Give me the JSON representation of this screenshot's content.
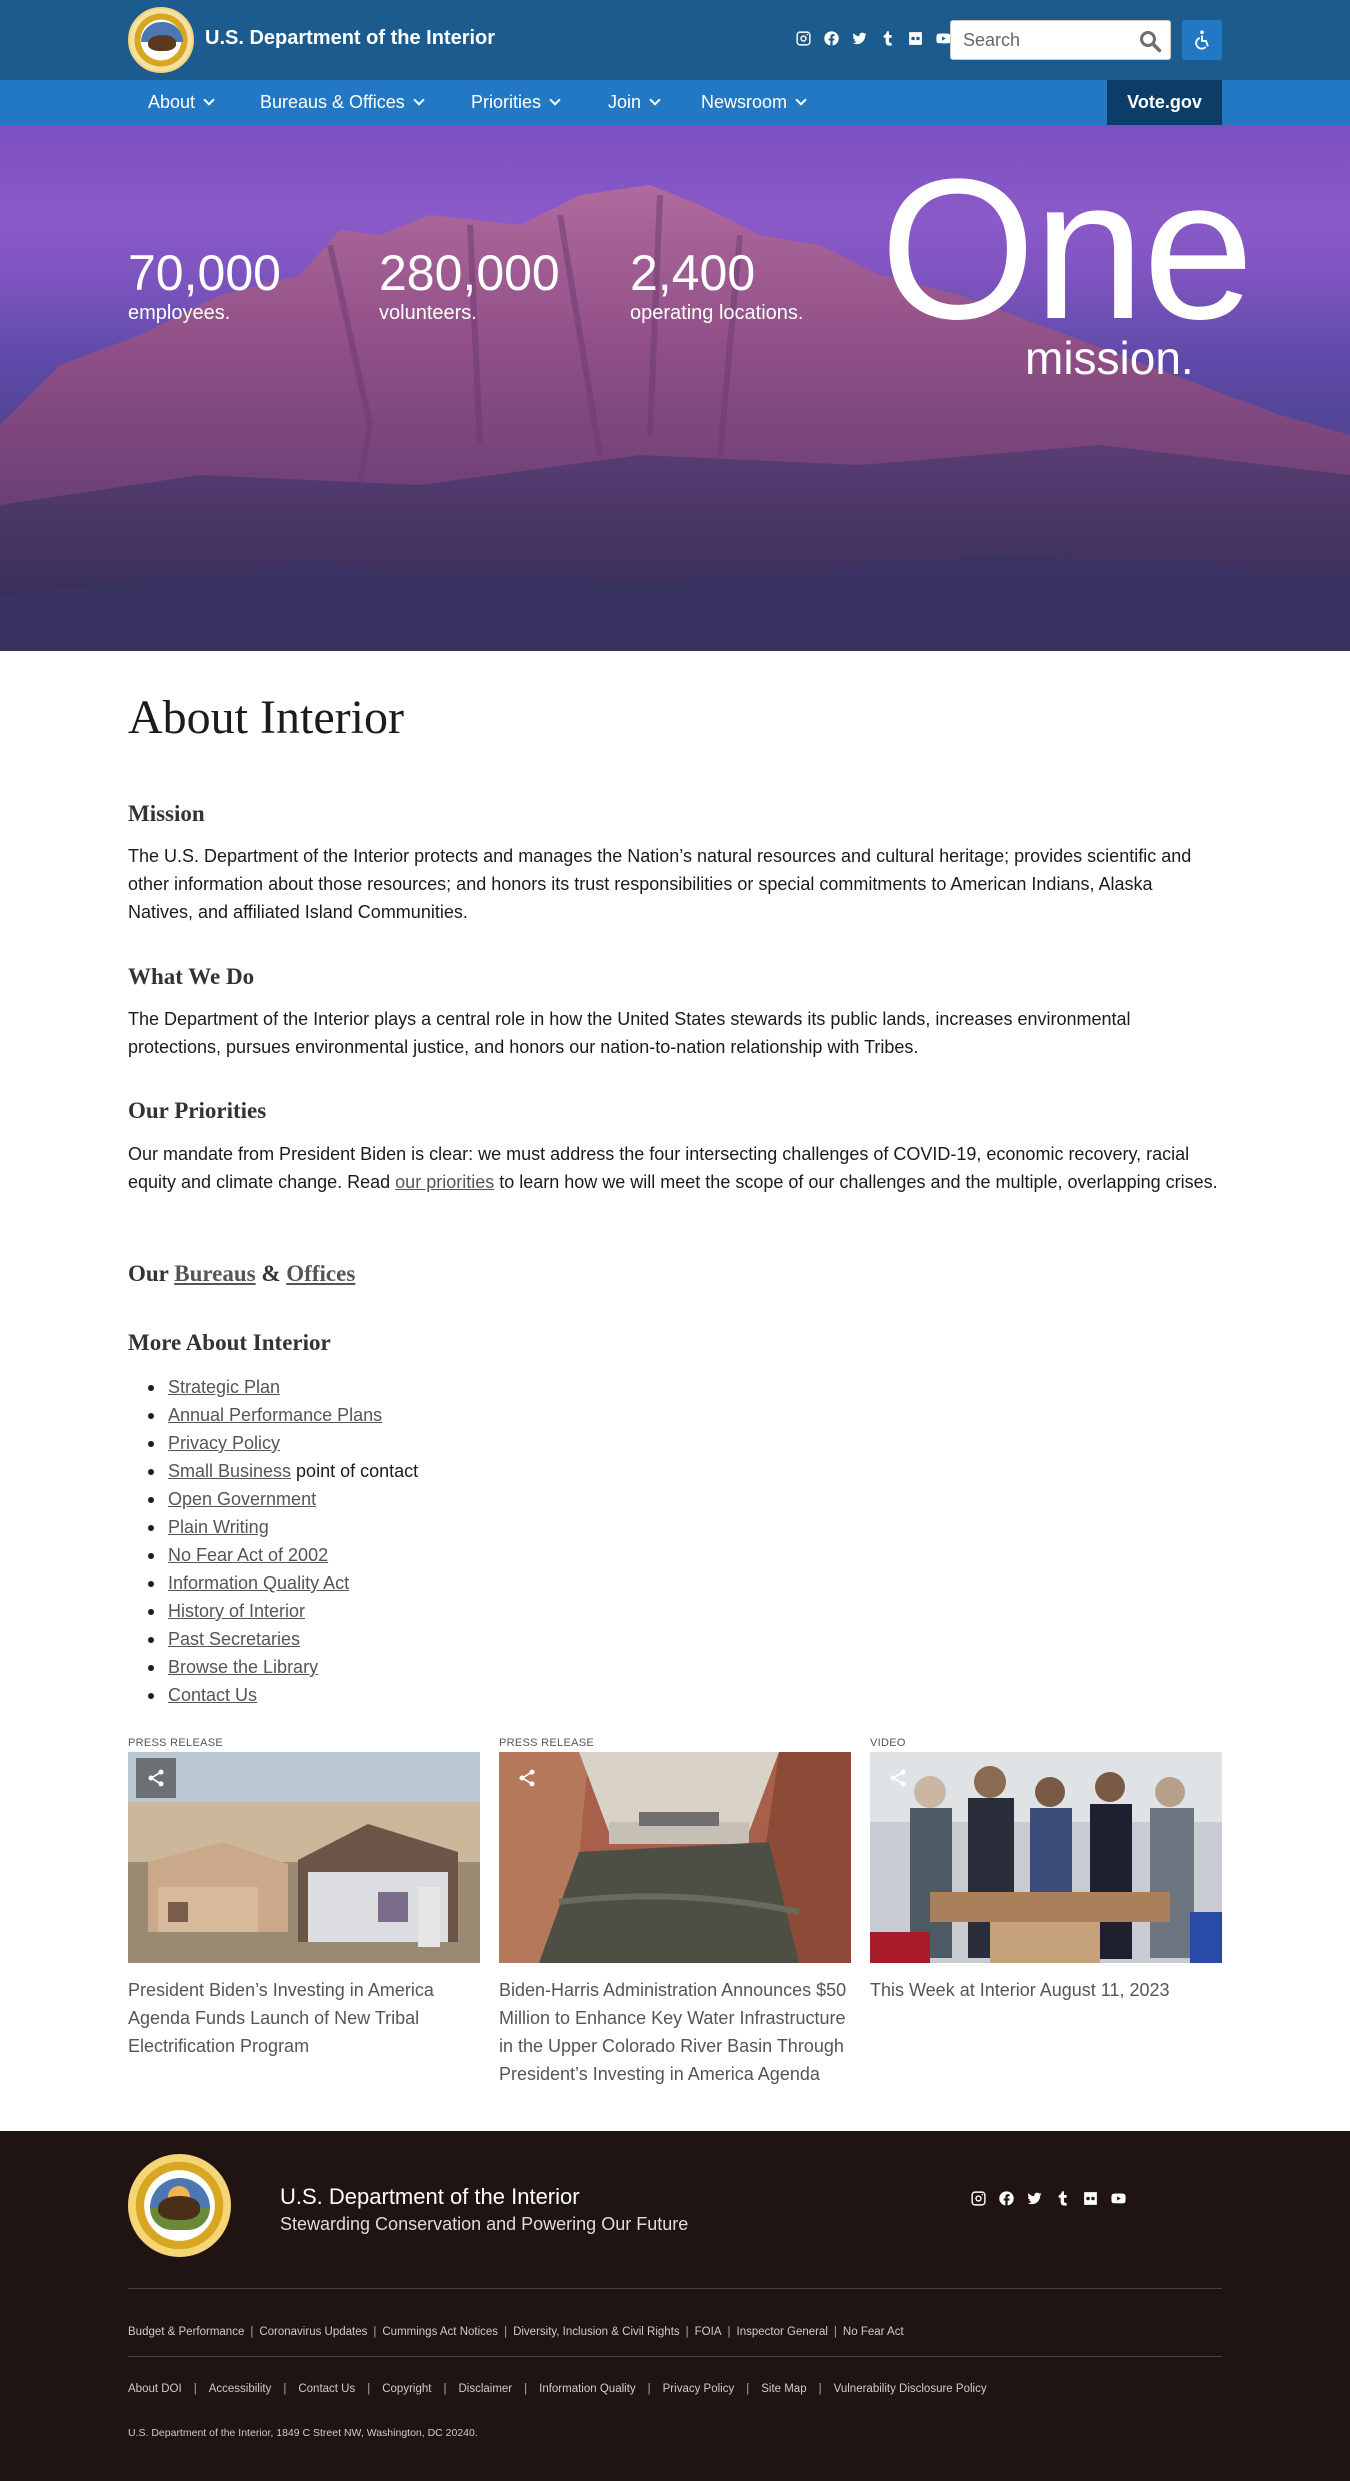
{
  "header": {
    "site_title": "U.S. Department of the Interior",
    "social_icons": [
      "instagram-icon",
      "facebook-icon",
      "twitter-icon",
      "tumblr-icon",
      "flickr-icon",
      "youtube-icon"
    ],
    "search_placeholder": "Search",
    "accessibility_icon": "accessibility-icon"
  },
  "nav": {
    "items": [
      {
        "label": "About"
      },
      {
        "label": "Bureaus & Offices"
      },
      {
        "label": "Priorities"
      },
      {
        "label": "Join"
      },
      {
        "label": "Newsroom"
      }
    ],
    "vote_label": "Vote.gov"
  },
  "hero": {
    "stats": [
      {
        "number": "70,000",
        "label": "employees."
      },
      {
        "number": "280,000",
        "label": "volunteers."
      },
      {
        "number": "2,400",
        "label": "operating locations."
      }
    ],
    "big_word": "One",
    "big_word_sub": "mission."
  },
  "content": {
    "page_title": "About Interior",
    "mission_heading": "Mission",
    "mission_text": "The U.S. Department of the Interior protects and manages the Nation’s natural resources and cultural heritage; provides scientific and other information about those resources; and honors its trust responsibilities or special commitments to American Indians, Alaska Natives, and affiliated Island Communities.",
    "whatwedo_heading": "What We Do",
    "whatwedo_text": "The Department of the Interior plays a central role in how the United States stewards its public lands, increases environmental protections, pursues environmental justice, and honors our nation-to-nation relationship with Tribes.",
    "priorities_heading": "Our Priorities",
    "priorities_text_1": "Our mandate from President Biden is clear: we must address the four intersecting challenges of COVID-19, economic recovery, racial equity and climate change. Read ",
    "priorities_link": "our priorities",
    "priorities_text_2": " to learn how we will meet the scope of our challenges and the multiple, overlapping crises.",
    "bureaus_prefix": "Our ",
    "bureaus_link": "Bureaus",
    "bureaus_amp": " & ",
    "offices_link": "Offices",
    "more_heading": "More About Interior",
    "more_links": [
      {
        "label": "Strategic Plan",
        "suffix": ""
      },
      {
        "label": "Annual Performance Plans",
        "suffix": ""
      },
      {
        "label": "Privacy Policy",
        "suffix": ""
      },
      {
        "label": "Small Business",
        "suffix": " point of contact"
      },
      {
        "label": "Open Government",
        "suffix": ""
      },
      {
        "label": "Plain Writing ",
        "suffix": ""
      },
      {
        "label": "No Fear Act of 2002",
        "suffix": ""
      },
      {
        "label": "Information Quality Act",
        "suffix": ""
      },
      {
        "label": "History of Interior",
        "suffix": ""
      },
      {
        "label": "Past Secretaries",
        "suffix": ""
      },
      {
        "label": "Browse the Library",
        "suffix": ""
      },
      {
        "label": "Contact Us",
        "suffix": ""
      }
    ]
  },
  "cards": [
    {
      "kind": "PRESS RELEASE",
      "headline": "President Biden’s Investing in America Agenda Funds Launch of New Tribal Electrification Program"
    },
    {
      "kind": "PRESS RELEASE",
      "headline": "Biden-Harris Administration Announces $50 Million to Enhance Key Water Infrastructure in the Upper Colorado River Basin Through President’s Investing in America Agenda"
    },
    {
      "kind": "VIDEO",
      "headline": "This Week at Interior August 11, 2023"
    }
  ],
  "footer": {
    "org": "U.S. Department of the Interior",
    "tagline": "Stewarding Conservation and Powering Our Future",
    "row1": [
      "Budget & Performance",
      "Coronavirus Updates",
      "Cummings Act Notices",
      "Diversity, Inclusion & Civil Rights",
      "FOIA",
      "Inspector General",
      "No Fear Act"
    ],
    "row2": [
      "About DOI",
      "Accessibility",
      "Contact Us",
      "Copyright",
      "Disclaimer",
      "Information Quality",
      "Privacy Policy",
      "Site Map",
      "Vulnerability Disclosure Policy"
    ],
    "address": "U.S. Department of the Interior, 1849 C Street NW, Washington, DC 20240."
  },
  "colors": {
    "header_bg": "#1c5b8e",
    "nav_bg": "#2378c3",
    "vote_bg": "#0c3d66",
    "footer_bg": "#1f1412"
  }
}
